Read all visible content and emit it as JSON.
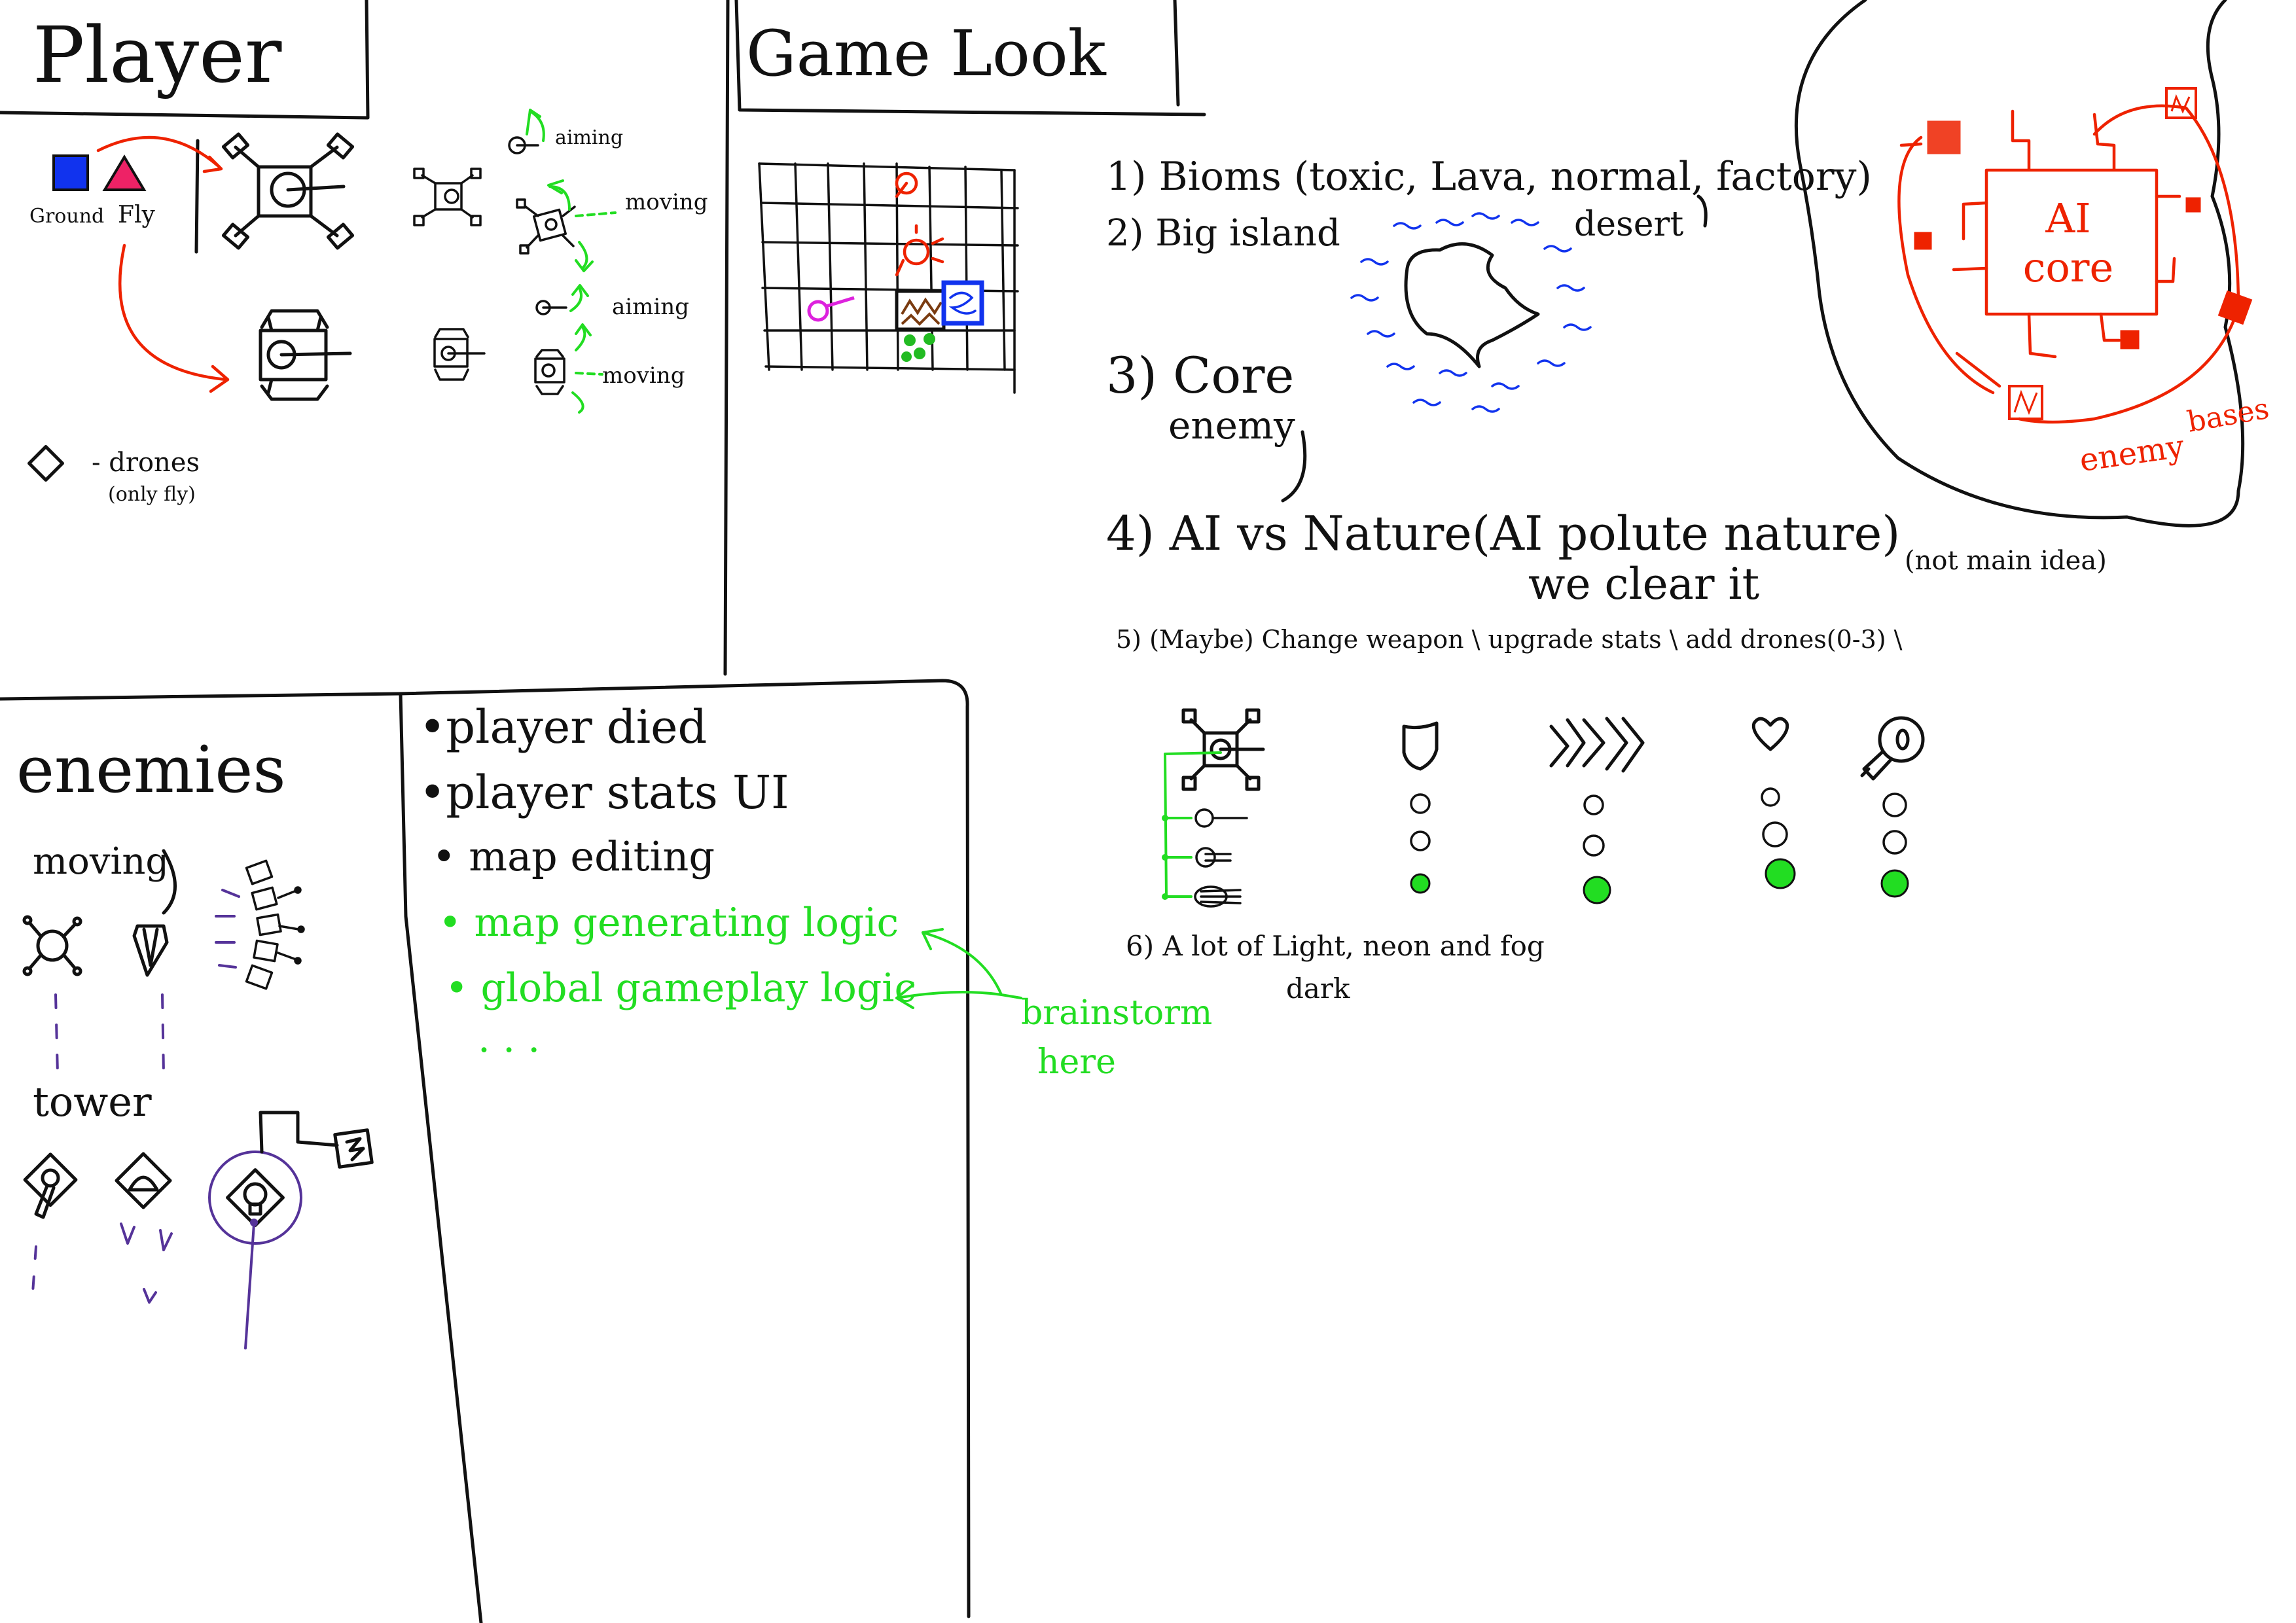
{
  "player": {
    "title": "Player",
    "ground_label": "Ground",
    "fly_label": "Fly",
    "aiming_1": "aiming",
    "moving_1": "moving",
    "aiming_2": "aiming",
    "moving_2": "moving",
    "drones_label": "- drones",
    "drones_note": "(only fly)"
  },
  "game_look": {
    "title": "Game Look",
    "items": [
      "1) Bioms (toxic, Lava, normal, factory)",
      "2) Big island",
      "desert",
      "3) Core",
      "enemy",
      "4) AI vs Nature(AI polute nature)",
      "we clear it",
      "(not main idea)",
      "5) (Maybe) Change weapon \\ upgrade stats \\ add drones(0-3) \\",
      "6) A lot of Light, neon and fog",
      "dark"
    ]
  },
  "ai_core": {
    "label_1": "AI",
    "label_2": "core",
    "bases_1": "enemy",
    "bases_2": "bases"
  },
  "enemies": {
    "title": "enemies",
    "moving": "moving",
    "tower": "tower"
  },
  "todo": {
    "items": [
      "•player died",
      "•player stats UI",
      "• map editing"
    ],
    "green_items": [
      "• map generating logic",
      "• global gameplay logic",
      "· · ·"
    ],
    "brainstorm_1": "brainstorm",
    "brainstorm_2": "here"
  },
  "colors": {
    "ink": "#111111",
    "red": "#ee2200",
    "green": "#22dd22",
    "blue": "#1133ee",
    "magenta": "#dd22dd",
    "purple": "#553399"
  }
}
